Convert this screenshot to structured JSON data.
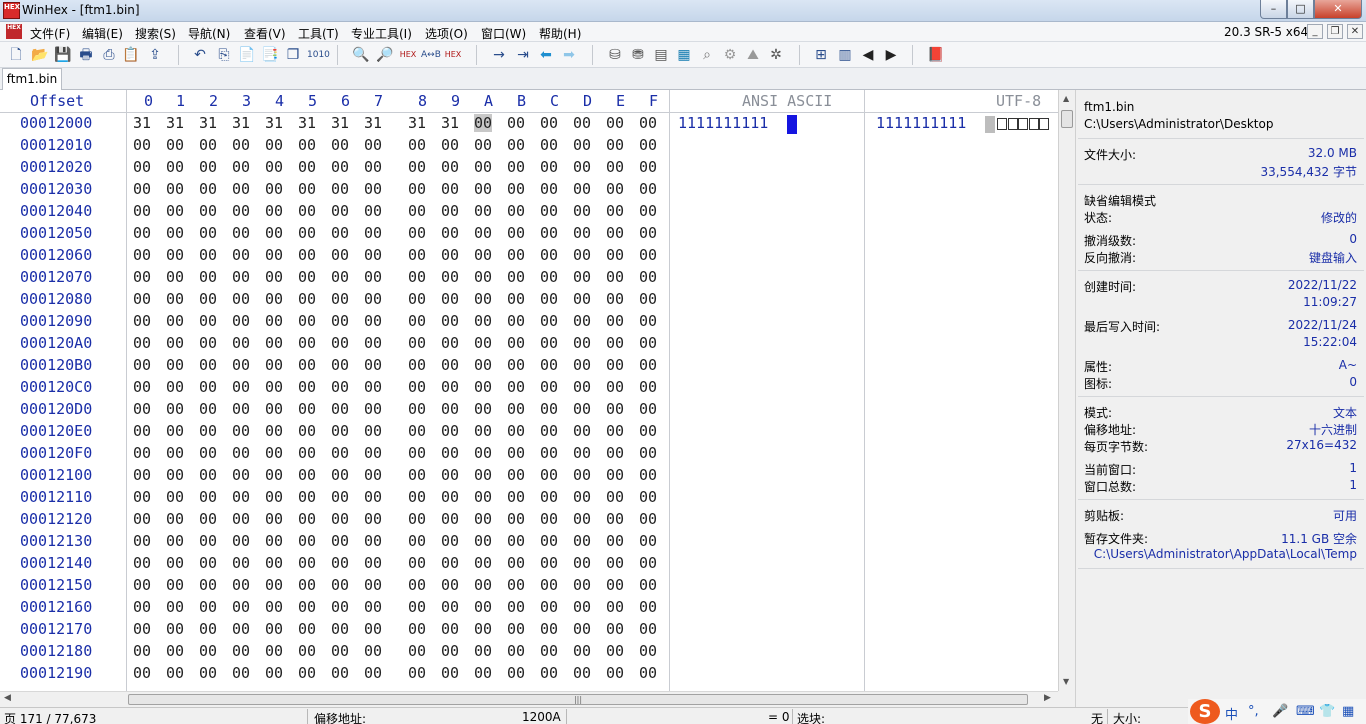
{
  "window": {
    "title": "WinHex - [ftm1.bin]",
    "app_icon": "HEX",
    "min": "–",
    "max": "□",
    "close": "✕"
  },
  "menu": {
    "items": [
      "文件(F)",
      "编辑(E)",
      "搜索(S)",
      "导航(N)",
      "查看(V)",
      "工具(T)",
      "专业工具(I)",
      "选项(O)",
      "窗口(W)",
      "帮助(H)"
    ],
    "version": "20.3 SR-5 x64",
    "mdi_min": "_",
    "mdi_restore": "❐",
    "mdi_close": "✕"
  },
  "toolbar": {
    "icons": [
      "new-file-icon",
      "open-file-icon",
      "save-icon",
      "print-icon",
      "print-preview-icon",
      "properties-icon",
      "export-icon",
      "undo-icon",
      "copy-icon",
      "paste-icon",
      "paste-special-icon",
      "copy-block-icon",
      "hex-convert-icon",
      "find-icon",
      "find-next-icon",
      "find-hex-icon",
      "replace-icon",
      "replace-hex-icon",
      "goto-icon",
      "goto-offset-icon",
      "back-icon",
      "forward-icon",
      "disk-icon",
      "disk-edit-icon",
      "ram-icon",
      "calculator-icon",
      "search-icon",
      "settings-icon",
      "hash-icon",
      "gear-icon",
      "tile-icon",
      "columns-icon",
      "prev-icon",
      "next-icon",
      "book-icon"
    ]
  },
  "tabs": [
    {
      "label": "ftm1.bin"
    }
  ],
  "hex": {
    "header": {
      "offset": "Offset",
      "columns": [
        "0",
        "1",
        "2",
        "3",
        "4",
        "5",
        "6",
        "7",
        "8",
        "9",
        "A",
        "B",
        "C",
        "D",
        "E",
        "F"
      ],
      "ansi": "ANSI ASCII",
      "utf8": "UTF-8"
    },
    "rows": [
      {
        "offset": "00012000",
        "bytes": [
          "31",
          "31",
          "31",
          "31",
          "31",
          "31",
          "31",
          "31",
          "31",
          "31",
          "00",
          "00",
          "00",
          "00",
          "00",
          "00"
        ],
        "ansi": "1111111111",
        "utf8": "1111111111"
      },
      {
        "offset": "00012010",
        "bytes": [
          "00",
          "00",
          "00",
          "00",
          "00",
          "00",
          "00",
          "00",
          "00",
          "00",
          "00",
          "00",
          "00",
          "00",
          "00",
          "00"
        ]
      },
      {
        "offset": "00012020",
        "bytes": [
          "00",
          "00",
          "00",
          "00",
          "00",
          "00",
          "00",
          "00",
          "00",
          "00",
          "00",
          "00",
          "00",
          "00",
          "00",
          "00"
        ]
      },
      {
        "offset": "00012030",
        "bytes": [
          "00",
          "00",
          "00",
          "00",
          "00",
          "00",
          "00",
          "00",
          "00",
          "00",
          "00",
          "00",
          "00",
          "00",
          "00",
          "00"
        ]
      },
      {
        "offset": "00012040",
        "bytes": [
          "00",
          "00",
          "00",
          "00",
          "00",
          "00",
          "00",
          "00",
          "00",
          "00",
          "00",
          "00",
          "00",
          "00",
          "00",
          "00"
        ]
      },
      {
        "offset": "00012050",
        "bytes": [
          "00",
          "00",
          "00",
          "00",
          "00",
          "00",
          "00",
          "00",
          "00",
          "00",
          "00",
          "00",
          "00",
          "00",
          "00",
          "00"
        ]
      },
      {
        "offset": "00012060",
        "bytes": [
          "00",
          "00",
          "00",
          "00",
          "00",
          "00",
          "00",
          "00",
          "00",
          "00",
          "00",
          "00",
          "00",
          "00",
          "00",
          "00"
        ]
      },
      {
        "offset": "00012070",
        "bytes": [
          "00",
          "00",
          "00",
          "00",
          "00",
          "00",
          "00",
          "00",
          "00",
          "00",
          "00",
          "00",
          "00",
          "00",
          "00",
          "00"
        ]
      },
      {
        "offset": "00012080",
        "bytes": [
          "00",
          "00",
          "00",
          "00",
          "00",
          "00",
          "00",
          "00",
          "00",
          "00",
          "00",
          "00",
          "00",
          "00",
          "00",
          "00"
        ]
      },
      {
        "offset": "00012090",
        "bytes": [
          "00",
          "00",
          "00",
          "00",
          "00",
          "00",
          "00",
          "00",
          "00",
          "00",
          "00",
          "00",
          "00",
          "00",
          "00",
          "00"
        ]
      },
      {
        "offset": "000120A0",
        "bytes": [
          "00",
          "00",
          "00",
          "00",
          "00",
          "00",
          "00",
          "00",
          "00",
          "00",
          "00",
          "00",
          "00",
          "00",
          "00",
          "00"
        ]
      },
      {
        "offset": "000120B0",
        "bytes": [
          "00",
          "00",
          "00",
          "00",
          "00",
          "00",
          "00",
          "00",
          "00",
          "00",
          "00",
          "00",
          "00",
          "00",
          "00",
          "00"
        ]
      },
      {
        "offset": "000120C0",
        "bytes": [
          "00",
          "00",
          "00",
          "00",
          "00",
          "00",
          "00",
          "00",
          "00",
          "00",
          "00",
          "00",
          "00",
          "00",
          "00",
          "00"
        ]
      },
      {
        "offset": "000120D0",
        "bytes": [
          "00",
          "00",
          "00",
          "00",
          "00",
          "00",
          "00",
          "00",
          "00",
          "00",
          "00",
          "00",
          "00",
          "00",
          "00",
          "00"
        ]
      },
      {
        "offset": "000120E0",
        "bytes": [
          "00",
          "00",
          "00",
          "00",
          "00",
          "00",
          "00",
          "00",
          "00",
          "00",
          "00",
          "00",
          "00",
          "00",
          "00",
          "00"
        ]
      },
      {
        "offset": "000120F0",
        "bytes": [
          "00",
          "00",
          "00",
          "00",
          "00",
          "00",
          "00",
          "00",
          "00",
          "00",
          "00",
          "00",
          "00",
          "00",
          "00",
          "00"
        ]
      },
      {
        "offset": "00012100",
        "bytes": [
          "00",
          "00",
          "00",
          "00",
          "00",
          "00",
          "00",
          "00",
          "00",
          "00",
          "00",
          "00",
          "00",
          "00",
          "00",
          "00"
        ]
      },
      {
        "offset": "00012110",
        "bytes": [
          "00",
          "00",
          "00",
          "00",
          "00",
          "00",
          "00",
          "00",
          "00",
          "00",
          "00",
          "00",
          "00",
          "00",
          "00",
          "00"
        ]
      },
      {
        "offset": "00012120",
        "bytes": [
          "00",
          "00",
          "00",
          "00",
          "00",
          "00",
          "00",
          "00",
          "00",
          "00",
          "00",
          "00",
          "00",
          "00",
          "00",
          "00"
        ]
      },
      {
        "offset": "00012130",
        "bytes": [
          "00",
          "00",
          "00",
          "00",
          "00",
          "00",
          "00",
          "00",
          "00",
          "00",
          "00",
          "00",
          "00",
          "00",
          "00",
          "00"
        ]
      },
      {
        "offset": "00012140",
        "bytes": [
          "00",
          "00",
          "00",
          "00",
          "00",
          "00",
          "00",
          "00",
          "00",
          "00",
          "00",
          "00",
          "00",
          "00",
          "00",
          "00"
        ]
      },
      {
        "offset": "00012150",
        "bytes": [
          "00",
          "00",
          "00",
          "00",
          "00",
          "00",
          "00",
          "00",
          "00",
          "00",
          "00",
          "00",
          "00",
          "00",
          "00",
          "00"
        ]
      },
      {
        "offset": "00012160",
        "bytes": [
          "00",
          "00",
          "00",
          "00",
          "00",
          "00",
          "00",
          "00",
          "00",
          "00",
          "00",
          "00",
          "00",
          "00",
          "00",
          "00"
        ]
      },
      {
        "offset": "00012170",
        "bytes": [
          "00",
          "00",
          "00",
          "00",
          "00",
          "00",
          "00",
          "00",
          "00",
          "00",
          "00",
          "00",
          "00",
          "00",
          "00",
          "00"
        ]
      },
      {
        "offset": "00012180",
        "bytes": [
          "00",
          "00",
          "00",
          "00",
          "00",
          "00",
          "00",
          "00",
          "00",
          "00",
          "00",
          "00",
          "00",
          "00",
          "00",
          "00"
        ]
      },
      {
        "offset": "00012190",
        "bytes": [
          "00",
          "00",
          "00",
          "00",
          "00",
          "00",
          "00",
          "00",
          "00",
          "00",
          "00",
          "00",
          "00",
          "00",
          "00",
          "00"
        ]
      }
    ],
    "cursor_col": 10
  },
  "info": {
    "filename": "ftm1.bin",
    "path": "C:\\Users\\Administrator\\Desktop",
    "size_label": "文件大小:",
    "size_mb": "32.0 MB",
    "size_bytes": "33,554,432 字节",
    "edit_mode_label": "缺省编辑模式",
    "state_label": "状态:",
    "state": "修改的",
    "undo_label": "撤消级数:",
    "undo": "0",
    "redo_label": "反向撤消:",
    "redo": "键盘输入",
    "created_label": "创建时间:",
    "created_date": "2022/11/22",
    "created_time": "11:09:27",
    "written_label": "最后写入时间:",
    "written_date": "2022/11/24",
    "written_time": "15:22:04",
    "attr_label": "属性:",
    "attr": "A~",
    "icon_label": "图标:",
    "icon": "0",
    "mode_label": "模式:",
    "mode": "文本",
    "offsetfmt_label": "偏移地址:",
    "offsetfmt": "十六进制",
    "bpp_label": "每页字节数:",
    "bpp": "27x16=432",
    "curwin_label": "当前窗口:",
    "curwin": "1",
    "totwin_label": "窗口总数:",
    "totwin": "1",
    "clip_label": "剪贴板:",
    "clip": "可用",
    "temp_label": "暂存文件夹:",
    "temp_free": "11.1 GB 空余",
    "temp_path": "C:\\Users\\Administrator\\AppData\\Local\\Temp"
  },
  "status": {
    "page": "页 171 / 77,673",
    "offset_label": "偏移地址:",
    "offset": "1200A",
    "eq": "= 0",
    "sel_label": "选块:",
    "none": "无",
    "size_label": "大小:"
  },
  "ime": {
    "logo": "S",
    "lang": "中",
    "punct": "°,",
    "mic": "🎤",
    "keyboard": "⌨",
    "shirt": "👕",
    "grid": "▦"
  }
}
